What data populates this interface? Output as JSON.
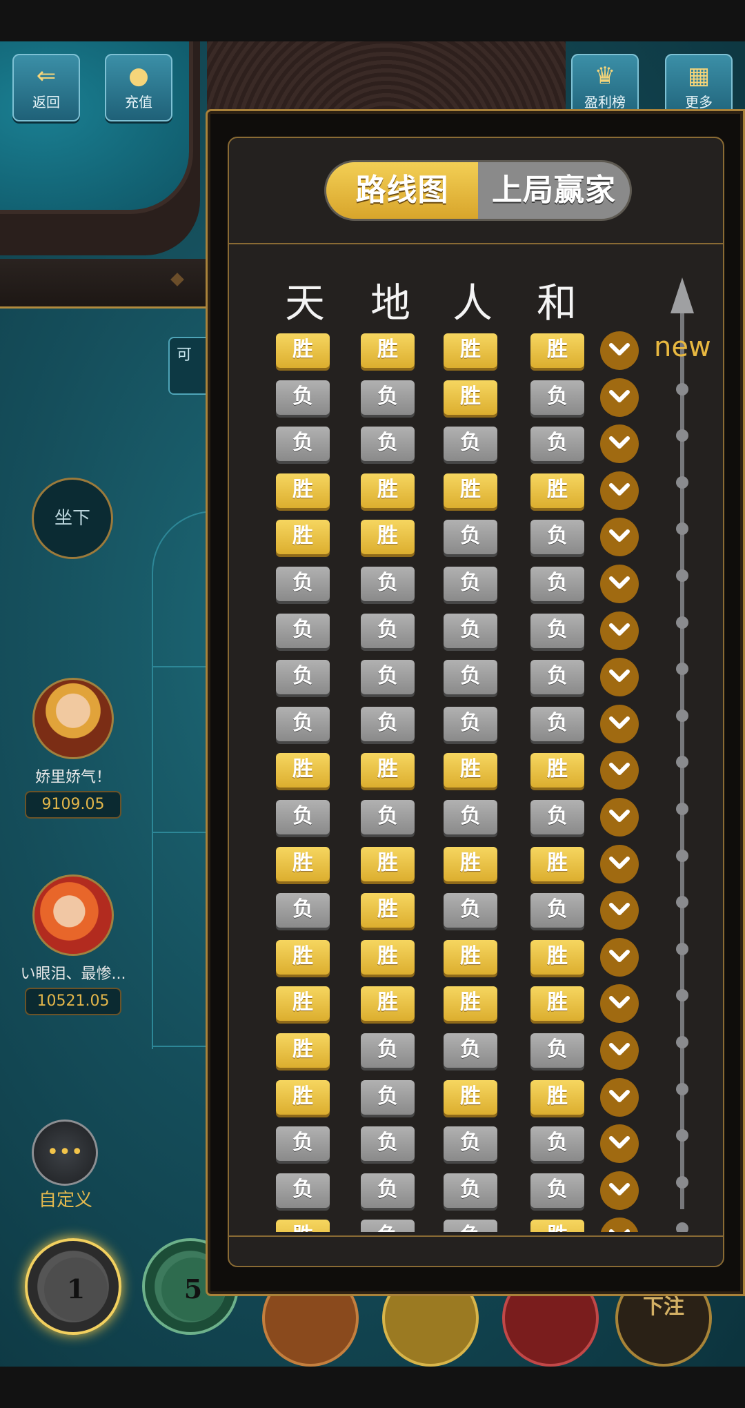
{
  "top_buttons": {
    "back": "返回",
    "recharge": "充值",
    "leaderboard": "盈利榜",
    "more": "更多"
  },
  "table": {
    "available_label": "可",
    "seat_label": "坐下"
  },
  "players": [
    {
      "name": "娇里娇气！",
      "chips": "9109.05"
    },
    {
      "name": "い眼泪、最惨...",
      "chips": "10521.05"
    }
  ],
  "custom_label": "自定义",
  "bet_chips": [
    "1",
    "5"
  ],
  "bet_button_label": "下注",
  "panel": {
    "tabs": [
      {
        "label": "路线图",
        "active": true
      },
      {
        "label": "上局赢家",
        "active": false
      }
    ],
    "columns": [
      "天",
      "地",
      "人",
      "和"
    ],
    "new_label": "new",
    "win_label": "胜",
    "lose_label": "负",
    "rows": [
      [
        "胜",
        "胜",
        "胜",
        "胜"
      ],
      [
        "负",
        "负",
        "胜",
        "负"
      ],
      [
        "负",
        "负",
        "负",
        "负"
      ],
      [
        "胜",
        "胜",
        "胜",
        "胜"
      ],
      [
        "胜",
        "胜",
        "负",
        "负"
      ],
      [
        "负",
        "负",
        "负",
        "负"
      ],
      [
        "负",
        "负",
        "负",
        "负"
      ],
      [
        "负",
        "负",
        "负",
        "负"
      ],
      [
        "负",
        "负",
        "负",
        "负"
      ],
      [
        "胜",
        "胜",
        "胜",
        "胜"
      ],
      [
        "负",
        "负",
        "负",
        "负"
      ],
      [
        "胜",
        "胜",
        "胜",
        "胜"
      ],
      [
        "负",
        "胜",
        "负",
        "负"
      ],
      [
        "胜",
        "胜",
        "胜",
        "胜"
      ],
      [
        "胜",
        "胜",
        "胜",
        "胜"
      ],
      [
        "胜",
        "负",
        "负",
        "负"
      ],
      [
        "胜",
        "负",
        "胜",
        "胜"
      ],
      [
        "负",
        "负",
        "负",
        "负"
      ],
      [
        "负",
        "负",
        "负",
        "负"
      ],
      [
        "胜",
        "负",
        "负",
        "胜"
      ]
    ]
  },
  "colors": {
    "win": "#e8be3c",
    "lose": "#9c9c9c",
    "accent": "#a9823a",
    "expand": "#a06a11"
  }
}
